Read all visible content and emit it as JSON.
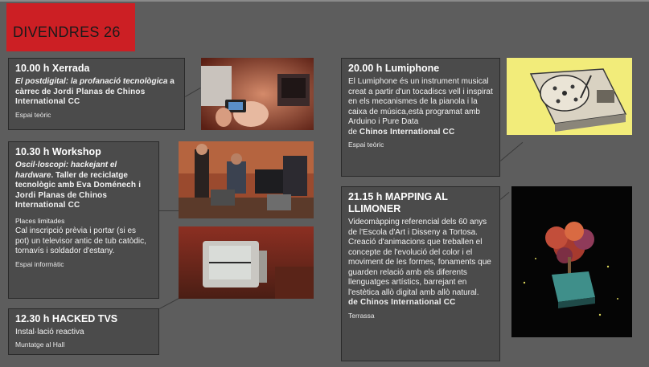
{
  "header": {
    "title": "DIVENDRES 26",
    "accent": "#cc1f24"
  },
  "events": {
    "xerrada": {
      "time": "10.00 h Xerrada",
      "title_italic": "El postdigital: la profanació tecnològica",
      "text_mid": " a càrrec de ",
      "speaker": "Jordi Planas",
      "text_de": " de ",
      "org": "Chinos International CC",
      "venue": "Espai teòric"
    },
    "workshop": {
      "time": "10.30 h Workshop",
      "title_italic": "Oscil·loscopi: hackejant el hardware",
      "text_mid": ". Taller de reciclatge tecnològic amb ",
      "speaker": "Eva Doménech i Jordi Planas",
      "text_de": " de ",
      "org": "Chinos International CC",
      "places": "Places limitades",
      "note": "Cal inscripció prèvia i portar (si es pot) un televisor antic de tub catòdic, tornavís i soldador d'estany.",
      "venue": "Espai informàtic"
    },
    "hacked": {
      "time": "12.30 h HACKED TVS",
      "text": "Instal·lació reactiva",
      "venue": "Muntatge al Hall"
    },
    "lumiphone": {
      "time": "20.00 h Lumiphone",
      "text": "El Lumiphone és un instrument musical creat a partir d'un tocadiscs vell i inspirat en els mecanismes de la pianola i la caixa de música,està programat amb Arduino i Pure Data",
      "text_de": "de ",
      "org": "Chinos International CC",
      "venue": "Espai teòric"
    },
    "mapping": {
      "time": "21.15 h MAPPING AL LLIMONER",
      "text": "Videomàpping referencial dels 60 anys de l'Escola d'Art i Disseny a Tortosa. Creació d'animacions que treballen el concepte de l'evolució del color i el moviment de les formes, fonaments que guarden relació amb els diferents llenguatges artístics, barrejant en l'estètica allò digital amb allò natural.",
      "org": "de Chinos International CC",
      "venue": "Terrassa"
    }
  }
}
